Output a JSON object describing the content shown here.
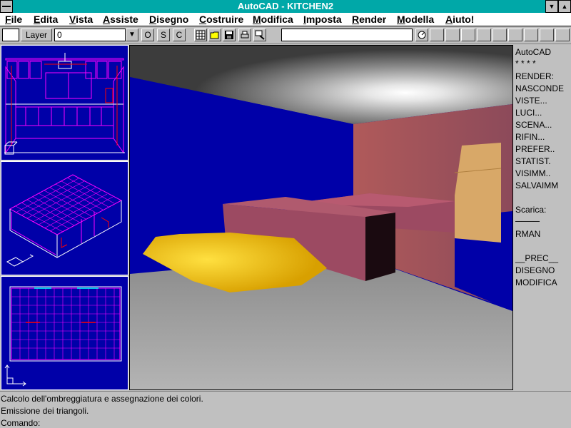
{
  "window": {
    "title": "AutoCAD - KITCHEN2"
  },
  "menu": [
    "File",
    "Edita",
    "Vista",
    "Assiste",
    "Disegno",
    "Costruire",
    "Modifica",
    "Imposta",
    "Render",
    "Modella",
    "Aiuto!"
  ],
  "toolbar": {
    "layer_label": "Layer",
    "layer_value": "0",
    "btn_o": "O",
    "btn_s": "S",
    "btn_c": "C"
  },
  "side_menu": {
    "items": [
      "AutoCAD",
      "* * * *",
      "RENDER:",
      "NASCONDE",
      "VISTE...",
      "LUCI...",
      "SCENA...",
      "RIFIN...",
      "PREFER..",
      "STATIST.",
      "VISIMM..",
      "SALVAIMM",
      "",
      "Scarica:",
      "────",
      "RMAN",
      "",
      "__PREC__",
      "DISEGNO",
      "MODIFICA"
    ]
  },
  "command": {
    "lines": [
      "Calcolo dell'ombreggiatura e assegnazione dei colori.",
      "Emissione dei triangoli.",
      "Comando:"
    ]
  },
  "colors": {
    "title_bar": "#00a8a8",
    "viewport_bg": "#0000a8",
    "wireframe_magenta": "#ff00ff",
    "wireframe_red": "#ff0000",
    "table_yellow": "#f0b000",
    "counter_maroon": "#9c4a62",
    "fridge_tan": "#d8a868",
    "floor_gray": "#9c9c9c"
  }
}
